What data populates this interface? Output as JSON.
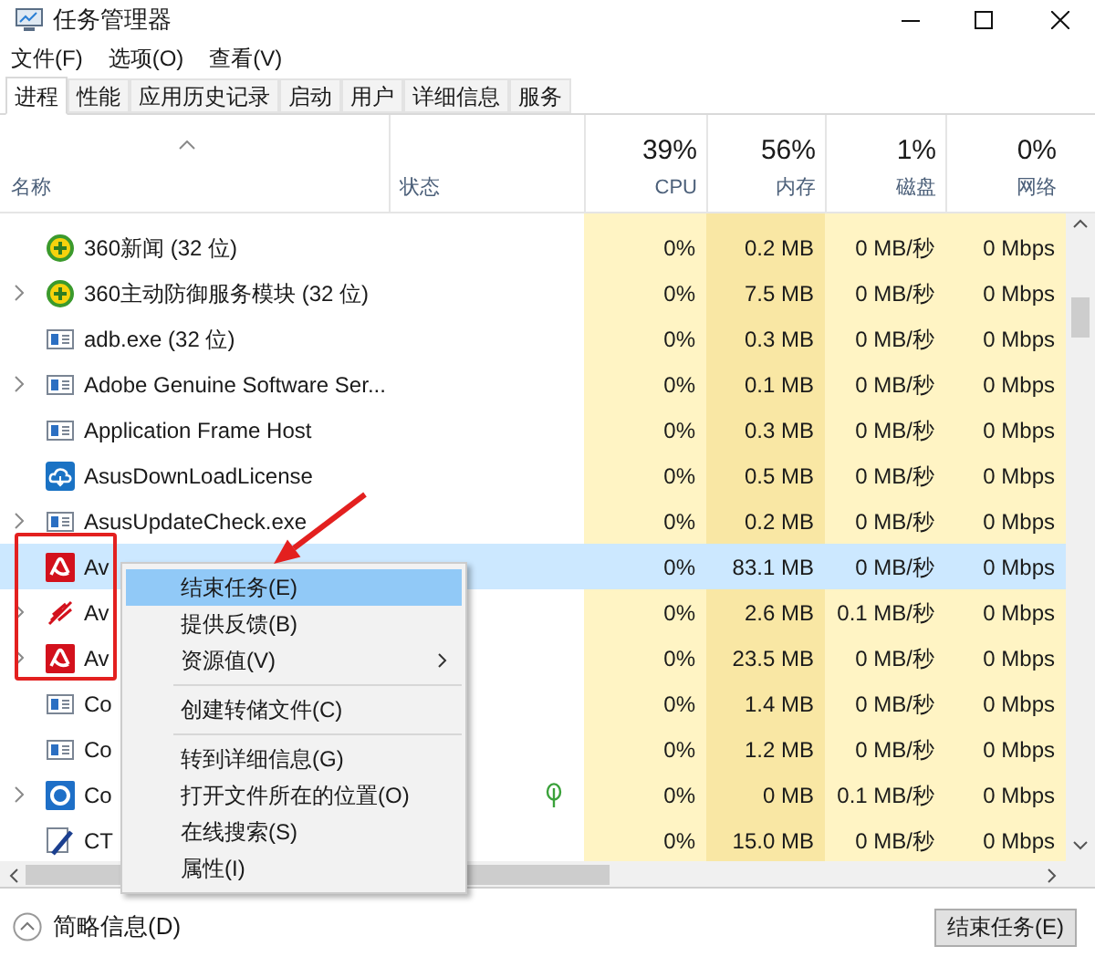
{
  "window": {
    "title": "任务管理器"
  },
  "menu_bar": [
    "文件(F)",
    "选项(O)",
    "查看(V)"
  ],
  "tabs": [
    {
      "label": "进程",
      "selected": true
    },
    {
      "label": "性能",
      "selected": false
    },
    {
      "label": "应用历史记录",
      "selected": false
    },
    {
      "label": "启动",
      "selected": false
    },
    {
      "label": "用户",
      "selected": false
    },
    {
      "label": "详细信息",
      "selected": false
    },
    {
      "label": "服务",
      "selected": false
    }
  ],
  "table": {
    "columns": [
      {
        "label": "名称",
        "sorted": true
      },
      {
        "label": "状态"
      },
      {
        "percent": "39%",
        "label": "CPU"
      },
      {
        "percent": "56%",
        "label": "内存"
      },
      {
        "percent": "1%",
        "label": "磁盘"
      },
      {
        "percent": "0%",
        "label": "网络"
      }
    ],
    "rows": [
      {
        "kind": "plus",
        "name": "360新闻 (32 位)",
        "expandable": false,
        "selected": false,
        "eco": false,
        "cpu": "0%",
        "memory": "0.2 MB",
        "disk": "0 MB/秒",
        "network": "0 Mbps"
      },
      {
        "kind": "plus",
        "name": "360主动防御服务模块 (32 位)",
        "expandable": true,
        "selected": false,
        "eco": false,
        "cpu": "0%",
        "memory": "7.5 MB",
        "disk": "0 MB/秒",
        "network": "0 Mbps"
      },
      {
        "kind": "app",
        "name": "adb.exe (32 位)",
        "expandable": false,
        "selected": false,
        "eco": false,
        "cpu": "0%",
        "memory": "0.3 MB",
        "disk": "0 MB/秒",
        "network": "0 Mbps"
      },
      {
        "kind": "app",
        "name": "Adobe Genuine Software Ser...",
        "expandable": true,
        "selected": false,
        "eco": false,
        "cpu": "0%",
        "memory": "0.1 MB",
        "disk": "0 MB/秒",
        "network": "0 Mbps"
      },
      {
        "kind": "app",
        "name": "Application Frame Host",
        "expandable": false,
        "selected": false,
        "eco": false,
        "cpu": "0%",
        "memory": "0.3 MB",
        "disk": "0 MB/秒",
        "network": "0 Mbps"
      },
      {
        "kind": "cloud",
        "name": "AsusDownLoadLicense",
        "expandable": false,
        "selected": false,
        "eco": false,
        "cpu": "0%",
        "memory": "0.5 MB",
        "disk": "0 MB/秒",
        "network": "0 Mbps"
      },
      {
        "kind": "app",
        "name": "AsusUpdateCheck.exe",
        "expandable": true,
        "selected": false,
        "eco": false,
        "cpu": "0%",
        "memory": "0.2 MB",
        "disk": "0 MB/秒",
        "network": "0 Mbps"
      },
      {
        "kind": "umbrella",
        "name": "Av",
        "expandable": false,
        "selected": true,
        "eco": false,
        "cpu": "0%",
        "memory": "83.1 MB",
        "disk": "0 MB/秒",
        "network": "0 Mbps"
      },
      {
        "kind": "feather",
        "name": "Av",
        "expandable": true,
        "selected": false,
        "eco": false,
        "cpu": "0%",
        "memory": "2.6 MB",
        "disk": "0.1 MB/秒",
        "network": "0 Mbps"
      },
      {
        "kind": "umbrella",
        "name": "Av",
        "expandable": true,
        "selected": false,
        "eco": false,
        "cpu": "0%",
        "memory": "23.5 MB",
        "disk": "0 MB/秒",
        "network": "0 Mbps"
      },
      {
        "kind": "app",
        "name": "Co",
        "expandable": false,
        "selected": false,
        "eco": false,
        "cpu": "0%",
        "memory": "1.4 MB",
        "disk": "0 MB/秒",
        "network": "0 Mbps"
      },
      {
        "kind": "app",
        "name": "Co",
        "expandable": false,
        "selected": false,
        "eco": false,
        "cpu": "0%",
        "memory": "1.2 MB",
        "disk": "0 MB/秒",
        "network": "0 Mbps"
      },
      {
        "kind": "ring",
        "name": "Co",
        "expandable": true,
        "selected": false,
        "eco": true,
        "cpu": "0%",
        "memory": "0 MB",
        "disk": "0.1 MB/秒",
        "network": "0 Mbps"
      },
      {
        "kind": "pen",
        "name": "CT",
        "expandable": false,
        "selected": false,
        "eco": false,
        "cpu": "0%",
        "memory": "15.0 MB",
        "disk": "0 MB/秒",
        "network": "0 Mbps"
      }
    ]
  },
  "context_menu": {
    "groups": [
      {
        "items": [
          {
            "label": "结束任务(E)",
            "selected": true,
            "submenu": false
          },
          {
            "label": "提供反馈(B)",
            "selected": false,
            "submenu": false
          },
          {
            "label": "资源值(V)",
            "selected": false,
            "submenu": true
          }
        ]
      },
      {
        "items": [
          {
            "label": "创建转储文件(C)",
            "selected": false,
            "submenu": false
          }
        ]
      },
      {
        "items": [
          {
            "label": "转到详细信息(G)",
            "selected": false,
            "submenu": false
          },
          {
            "label": "打开文件所在的位置(O)",
            "selected": false,
            "submenu": false
          },
          {
            "label": "在线搜索(S)",
            "selected": false,
            "submenu": false
          },
          {
            "label": "属性(I)",
            "selected": false,
            "submenu": false
          }
        ]
      }
    ]
  },
  "footer": {
    "details_toggle": "简略信息(D)",
    "end_task_button": "结束任务(E)"
  }
}
